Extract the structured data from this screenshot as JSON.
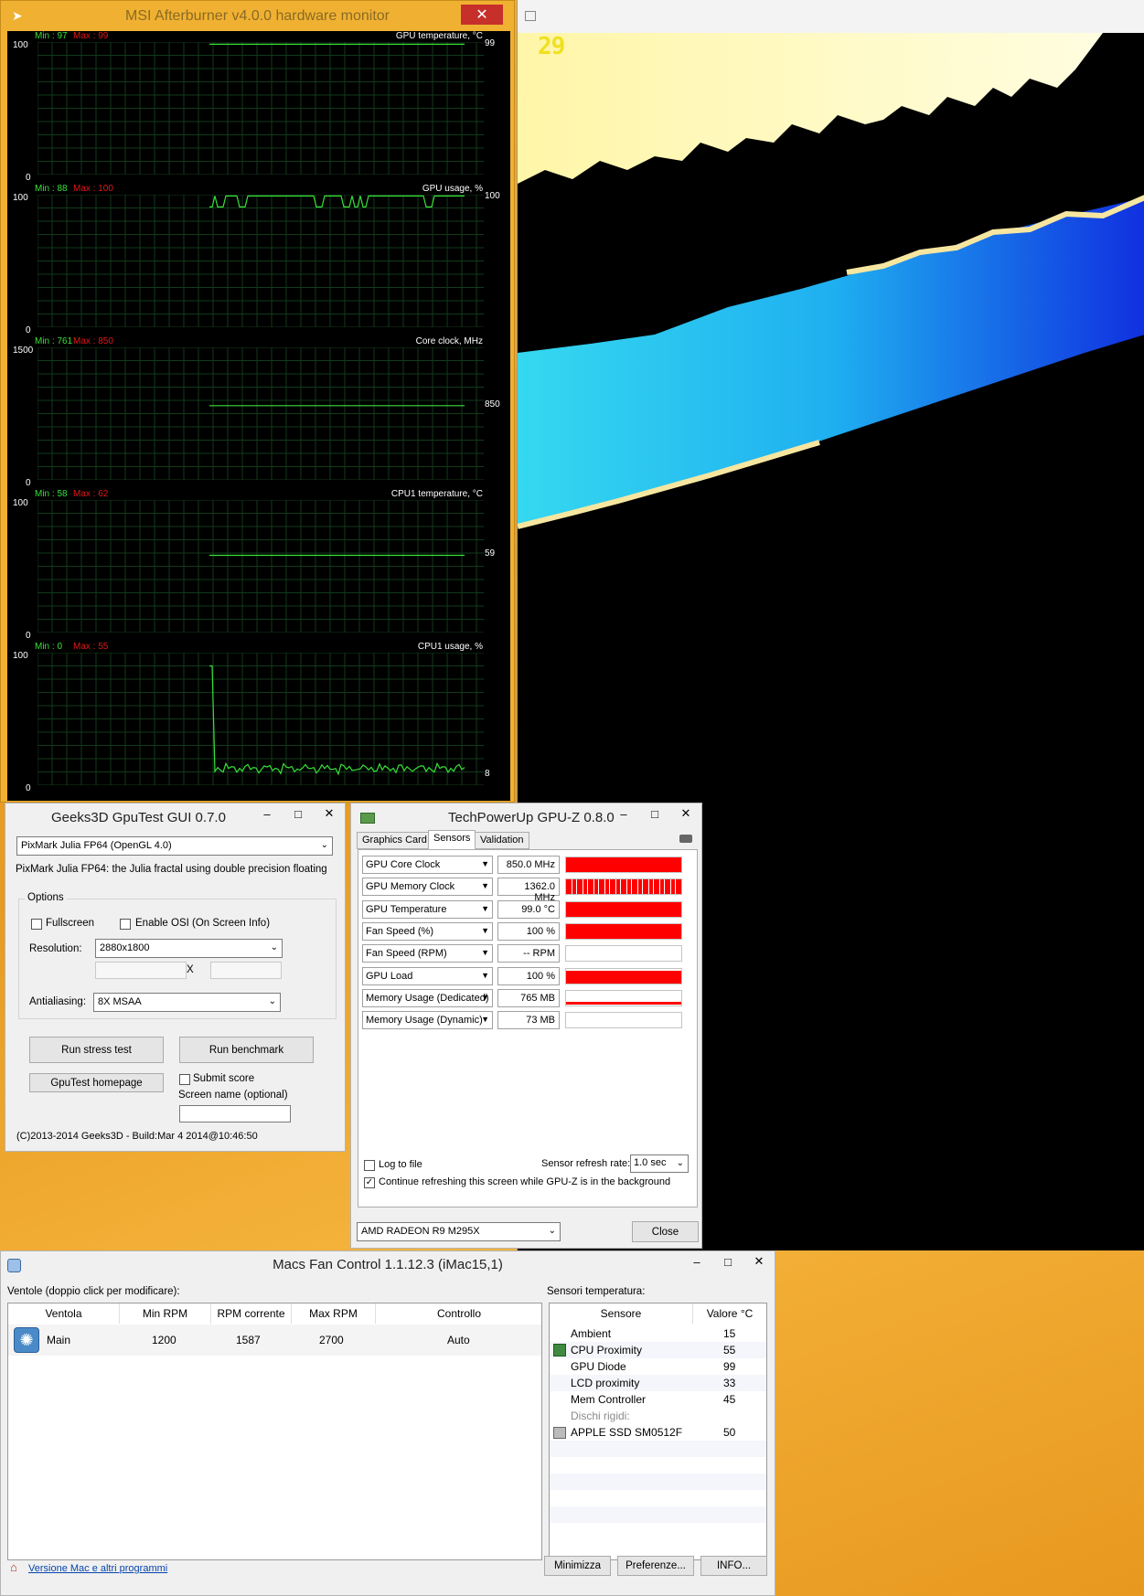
{
  "msi": {
    "title": "MSI Afterburner v4.0.0 hardware monitor",
    "close_icon": "✕",
    "graphs": [
      {
        "name": "GPU temperature, °C",
        "min": "Min : 97",
        "max": "Max : 99",
        "ymax": "100",
        "ymin": "0",
        "current": "99",
        "level": 0.99,
        "kind": "flat",
        "color": "#38e038"
      },
      {
        "name": "GPU usage, %",
        "min": "Min : 88",
        "max": "Max : 100",
        "ymax": "100",
        "ymin": "0",
        "current": "100",
        "level": 0.99,
        "kind": "dips",
        "color": "#38e038"
      },
      {
        "name": "Core clock, MHz",
        "min": "Min : 761",
        "max": "Max : 850",
        "ymax": "1500",
        "ymin": "0",
        "current": "850",
        "level": 0.567,
        "kind": "flat",
        "color": "#38e038"
      },
      {
        "name": "CPU1 temperature, °C",
        "min": "Min : 58",
        "max": "Max : 62",
        "ymax": "100",
        "ymin": "0",
        "current": "59",
        "level": 0.59,
        "kind": "flat",
        "color": "#38e038"
      },
      {
        "name": "CPU1 usage, %",
        "min": "Min : 0",
        "max": "Max : 55",
        "ymax": "100",
        "ymin": "0",
        "current": "8",
        "level": 0.08,
        "kind": "noisy",
        "color": "#38e038"
      }
    ]
  },
  "fractal": {
    "fps": "29"
  },
  "gputest": {
    "title": "Geeks3D GpuTest GUI 0.7.0",
    "test_select": "PixMark Julia FP64 (OpenGL 4.0)",
    "description": "PixMark Julia FP64: the Julia fractal using double precision floating",
    "options_label": "Options",
    "fullscreen_label": "Fullscreen",
    "osi_label": "Enable OSI (On Screen Info)",
    "resolution_label": "Resolution:",
    "resolution_value": "2880x1800",
    "x_label": "X",
    "antialiasing_label": "Antialiasing:",
    "antialiasing_value": "8X MSAA",
    "stress_button": "Run stress test",
    "benchmark_button": "Run benchmark",
    "homepage_button": "GpuTest homepage",
    "submit_label": "Submit score",
    "screen_name_label": "Screen name (optional)",
    "footer": "(C)2013-2014 Geeks3D - Build:Mar  4 2014@10:46:50"
  },
  "gpuz": {
    "title": "TechPowerUp GPU-Z 0.8.0",
    "tabs": [
      "Graphics Card",
      "Sensors",
      "Validation"
    ],
    "sensors": [
      {
        "name": "GPU Core Clock",
        "value": "850.0 MHz",
        "fill": 1.0,
        "pattern": "solid"
      },
      {
        "name": "GPU Memory Clock",
        "value": "1362.0 MHz",
        "fill": 1.0,
        "pattern": "striped"
      },
      {
        "name": "GPU Temperature",
        "value": "99.0 °C",
        "fill": 1.0,
        "pattern": "solid"
      },
      {
        "name": "Fan Speed (%)",
        "value": "100 %",
        "fill": 1.0,
        "pattern": "solid"
      },
      {
        "name": "Fan Speed (RPM)",
        "value": "-- RPM",
        "fill": 0,
        "pattern": "none"
      },
      {
        "name": "GPU Load",
        "value": "100 %",
        "fill": 1.0,
        "pattern": "rough"
      },
      {
        "name": "Memory Usage (Dedicated)",
        "value": "765 MB",
        "fill": 0.2,
        "pattern": "line"
      },
      {
        "name": "Memory Usage (Dynamic)",
        "value": "73 MB",
        "fill": 0,
        "pattern": "none"
      }
    ],
    "log_label": "Log to file",
    "refresh_label": "Sensor refresh rate:",
    "refresh_value": "1.0 sec",
    "continue_label": "Continue refreshing this screen while GPU-Z is in the background",
    "gpu_select": "AMD RADEON R9 M295X",
    "close_button": "Close",
    "bar_color": "#ff0000"
  },
  "mfc": {
    "title": "Macs Fan Control 1.1.12.3 (iMac15,1)",
    "fans_label": "Ventole (doppio click per modificare):",
    "fan_columns": [
      "Ventola",
      "Min RPM",
      "RPM corrente",
      "Max RPM",
      "Controllo"
    ],
    "fans": [
      {
        "name": "Main",
        "min": "1200",
        "current": "1587",
        "max": "2700",
        "control": "Auto"
      }
    ],
    "sensors_label": "Sensori temperatura:",
    "sensor_columns": [
      "Sensore",
      "Valore °C"
    ],
    "sensors": [
      {
        "name": "Ambient",
        "value": "15",
        "icon": ""
      },
      {
        "name": "CPU Proximity",
        "value": "55",
        "icon": "chip-icon"
      },
      {
        "name": "GPU Diode",
        "value": "99",
        "icon": ""
      },
      {
        "name": "LCD proximity",
        "value": "33",
        "icon": ""
      },
      {
        "name": "Mem Controller",
        "value": "45",
        "icon": ""
      }
    ],
    "disks_label": "Dischi rigidi:",
    "disks": [
      {
        "name": "APPLE SSD SM0512F",
        "value": "50",
        "icon": "disk-icon"
      }
    ],
    "footer_link": "Versione Mac e altri programmi",
    "minimize_button": "Minimizza",
    "prefs_button": "Preferenze...",
    "info_button": "INFO..."
  }
}
